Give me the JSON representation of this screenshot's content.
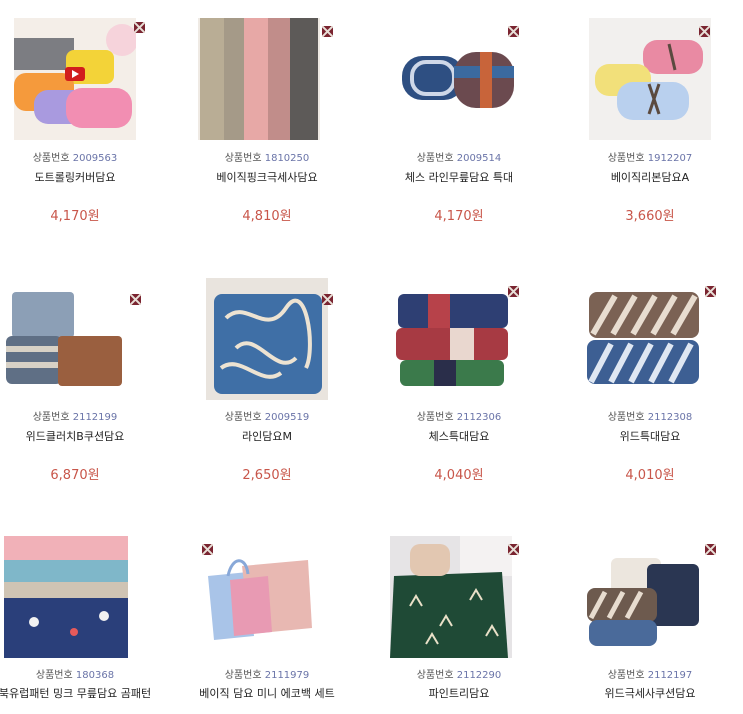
{
  "labels": {
    "code_prefix": "상품번호"
  },
  "colors": {
    "price": "#c8564a",
    "code_number": "#6a74a8",
    "flag_badge": "#7a2430"
  },
  "products": [
    {
      "code": "2009563",
      "name": "도트롤링커버담요",
      "price": "4,170원",
      "image": "rolled-colorful-blankets",
      "badge": "flag-icon",
      "video": true
    },
    {
      "code": "1810250",
      "name": "베이직핑크극세사담요",
      "price": "4,810원",
      "image": "hanging-fleece-blankets",
      "badge": "flag-icon"
    },
    {
      "code": "2009514",
      "name": "체스 라인무릎담요 특대",
      "price": "4,170원",
      "image": "rolled-blue-check-blankets",
      "badge": "flag-icon"
    },
    {
      "code": "1912207",
      "name": "베이직리본담요A",
      "price": "3,660원",
      "image": "ribbon-tied-blankets",
      "badge": "flag-icon"
    },
    {
      "code": "2112199",
      "name": "위드클러치B쿠션담요",
      "price": "6,870원",
      "image": "clutch-cushion-blanket",
      "badge": "flag-icon"
    },
    {
      "code": "2009519",
      "name": "라인담요M",
      "price": "2,650원",
      "image": "line-pattern-blanket",
      "badge": "flag-icon"
    },
    {
      "code": "2112306",
      "name": "체스특대담요",
      "price": "4,040원",
      "image": "folded-check-blankets",
      "badge": "flag-icon"
    },
    {
      "code": "2112308",
      "name": "위드특대담요",
      "price": "4,010원",
      "image": "folded-stripe-blankets",
      "badge": "flag-icon"
    },
    {
      "code": "180368",
      "name": "북유럽패턴 밍크 무릎담요 곰패턴",
      "price": "",
      "image": "nordic-mink-blankets",
      "badge": ""
    },
    {
      "code": "2111979",
      "name": "베이직 담요 미니 에코백 세트",
      "price": "",
      "image": "mini-ecobag-set",
      "badge": "flag-icon"
    },
    {
      "code": "2112290",
      "name": "파인트리담요",
      "price": "",
      "image": "pine-tree-blanket",
      "badge": "flag-icon"
    },
    {
      "code": "2112197",
      "name": "위드극세사쿠션담요",
      "price": "",
      "image": "fleece-cushion-blanket",
      "badge": "flag-icon"
    }
  ]
}
